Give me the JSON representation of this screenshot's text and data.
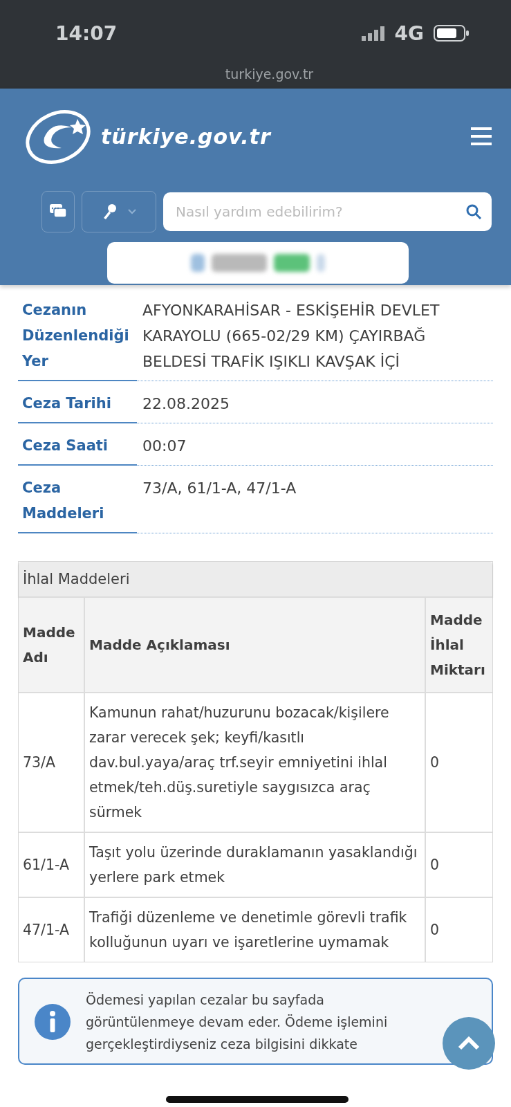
{
  "status_bar": {
    "time": "14:07",
    "network": "4G"
  },
  "browser": {
    "url": "turkiye.gov.tr"
  },
  "header": {
    "logo": "türkiye.gov.tr",
    "search": {
      "placeholder": "Nasıl yardım edebilirim?"
    }
  },
  "details": [
    {
      "label": "Cezanın Düzenlendiği Yer",
      "value": "AFYONKARAHİSAR - ESKİŞEHİR DEVLET KARAYOLU (665-02/29 KM) ÇAYIRBAĞ BELDESİ TRAFİK IŞIKLI KAVŞAK İÇİ"
    },
    {
      "label": "Ceza Tarihi",
      "value": "22.08.2025"
    },
    {
      "label": "Ceza Saati",
      "value": "00:07"
    },
    {
      "label": "Ceza Maddeleri",
      "value": "73/A, 61/1-A, 47/1-A"
    }
  ],
  "violations": {
    "title": "İhlal Maddeleri",
    "columns": [
      "Madde Adı",
      "Madde Açıklaması",
      "Madde İhlal Miktarı"
    ],
    "rows": [
      [
        "73/A",
        "Kamunun rahat/huzurunu bozacak/kişilere zarar verecek şek; keyfi/kasıtlı dav.bul.yaya/araç trf.seyir emniyetini ihlal etmek/teh.düş.suretiyle saygısızca araç sürmek",
        "0"
      ],
      [
        "61/1-A",
        "Taşıt yolu üzerinde duraklamanın yasaklandığı yerlere park etmek",
        "0"
      ],
      [
        "47/1-A",
        "Trafiği düzenleme ve denetimle görevli trafik kolluğunun uyarı ve işaretlerine uymamak",
        "0"
      ]
    ]
  },
  "info": {
    "text": "Ödemesi yapılan cezalar bu sayfada görüntülenmeye devam eder. Ödeme işlemini gerçekleştirdiyseniz ceza bilgisini dikkate"
  }
}
